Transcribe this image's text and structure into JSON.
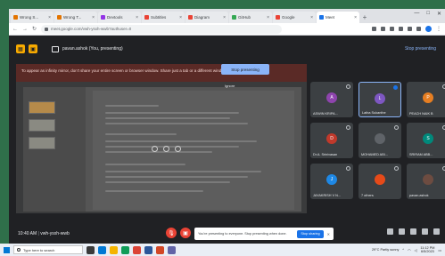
{
  "browser": {
    "tabs": [
      {
        "label": "Wrong S...",
        "color": "#e37400"
      },
      {
        "label": "Wrong T...",
        "color": "#e37400"
      },
      {
        "label": "Devtools",
        "color": "#9334e6"
      },
      {
        "label": "Subtitles",
        "color": "#ea4335"
      },
      {
        "label": "Diagram",
        "color": "#ea4335"
      },
      {
        "label": "GitHub",
        "color": "#34a853"
      },
      {
        "label": "Google",
        "color": "#ea4335"
      },
      {
        "label": "Meet",
        "color": "#1a73e8"
      }
    ],
    "active_tab": 7,
    "url": "meet.google.com/vwh-ysxh-wwb?authuser=0",
    "window_controls": [
      "—",
      "□",
      "✕"
    ]
  },
  "meet": {
    "presenter_title": "pavan.ashok (You, presenting)",
    "stop_presenting_top": "Stop presenting",
    "banner": {
      "message": "To appear as infinity mirror, don't share your entire screen or browser window. Share just a tab or a different window instead.",
      "button": "Stop presenting",
      "ignore": "Ignore"
    },
    "participants": [
      {
        "initial": "A",
        "name": "ASWIN KRIPA...",
        "color": "#8e44ad",
        "mic_on": false,
        "highlight": false
      },
      {
        "initial": "L",
        "name": "Latha Sukanthe",
        "color": "#7e57c2",
        "mic_on": true,
        "highlight": true
      },
      {
        "initial": "P",
        "name": "PEACH NAIK B",
        "color": "#e67e22",
        "mic_on": false,
        "highlight": false
      },
      {
        "initial": "D",
        "name": "Dr.A. Srinivasan",
        "color": "#c0392b",
        "mic_on": false,
        "highlight": false
      },
      {
        "initial": "",
        "name": "MOHAMED ABI...",
        "color": "#5f6368",
        "mic_on": false,
        "highlight": false
      },
      {
        "initial": "S",
        "name": "SRIRAM ABB...",
        "color": "#00897b",
        "mic_on": false,
        "highlight": false
      },
      {
        "initial": "J",
        "name": "JAYAKRISH V N...",
        "color": "#1e88e5",
        "mic_on": false,
        "highlight": false
      },
      {
        "initial": "",
        "name": "7 others",
        "color": "#e64a19",
        "mic_on": false,
        "highlight": false
      },
      {
        "initial": "",
        "name": "pavan.ashok",
        "color": "#6d4c41",
        "mic_on": false,
        "highlight": false
      }
    ],
    "bottom": {
      "time": "10:40 AM",
      "separator": "|",
      "meeting_code": "vwh-ysxh-wwb",
      "toast_message": "You're presenting to everyone. Stop presenting when done.",
      "toast_button": "Stop sharing",
      "toast_close": "✕"
    }
  },
  "taskbar": {
    "search_placeholder": "Type here to search",
    "weather": "29°C  Partly sunny",
    "clock_time": "11:12 PM",
    "clock_date": "6/5/2023"
  }
}
